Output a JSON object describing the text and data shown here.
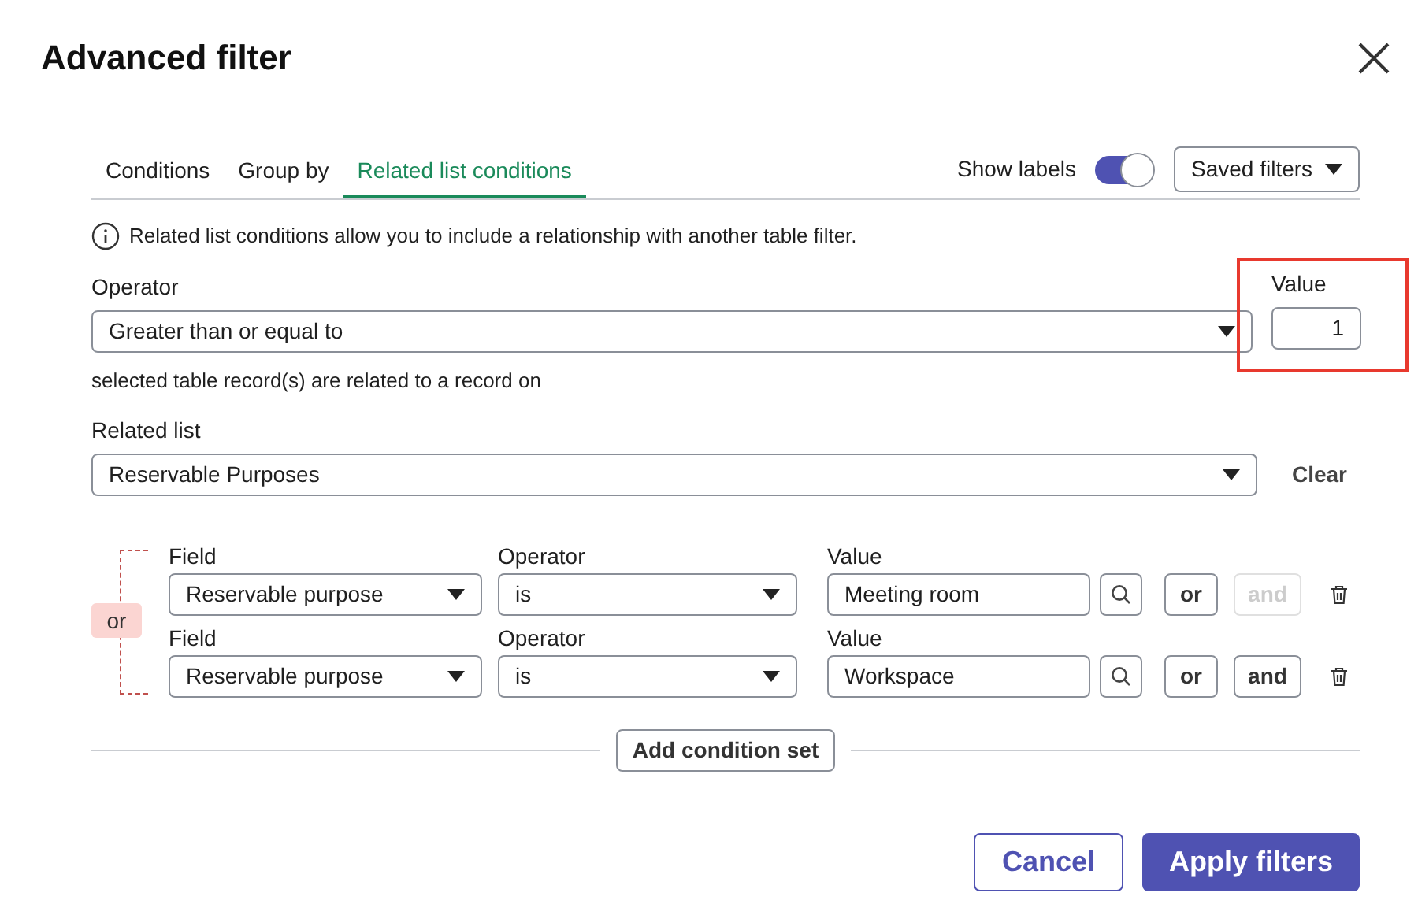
{
  "dialog": {
    "title": "Advanced filter"
  },
  "tabs": [
    {
      "label": "Conditions",
      "selected": false
    },
    {
      "label": "Group by",
      "selected": false
    },
    {
      "label": "Related list conditions",
      "selected": true
    }
  ],
  "show_labels": {
    "label": "Show labels",
    "on": true
  },
  "saved_filters": {
    "label": "Saved filters"
  },
  "info": "Related list conditions allow you to include a relationship with another table filter.",
  "operator": {
    "label": "Operator",
    "value": "Greater than or equal to"
  },
  "value": {
    "label": "Value",
    "value": "1",
    "highlighted": true
  },
  "relation_text": "selected table record(s) are related to a record on",
  "related_list": {
    "label": "Related list",
    "value": "Reservable Purposes"
  },
  "clear": "Clear",
  "condition_group": {
    "connector": "or",
    "conditions": [
      {
        "field_label": "Field",
        "field": "Reservable purpose",
        "operator_label": "Operator",
        "operator": "is",
        "value_label": "Value",
        "value": "Meeting room",
        "or": {
          "label": "or",
          "disabled": false
        },
        "and": {
          "label": "and",
          "disabled": true
        }
      },
      {
        "field_label": "Field",
        "field": "Reservable purpose",
        "operator_label": "Operator",
        "operator": "is",
        "value_label": "Value",
        "value": "Workspace",
        "or": {
          "label": "or",
          "disabled": false
        },
        "and": {
          "label": "and",
          "disabled": false
        }
      }
    ]
  },
  "add_condition_set": "Add condition set",
  "buttons": {
    "cancel": "Cancel",
    "apply": "Apply filters"
  }
}
